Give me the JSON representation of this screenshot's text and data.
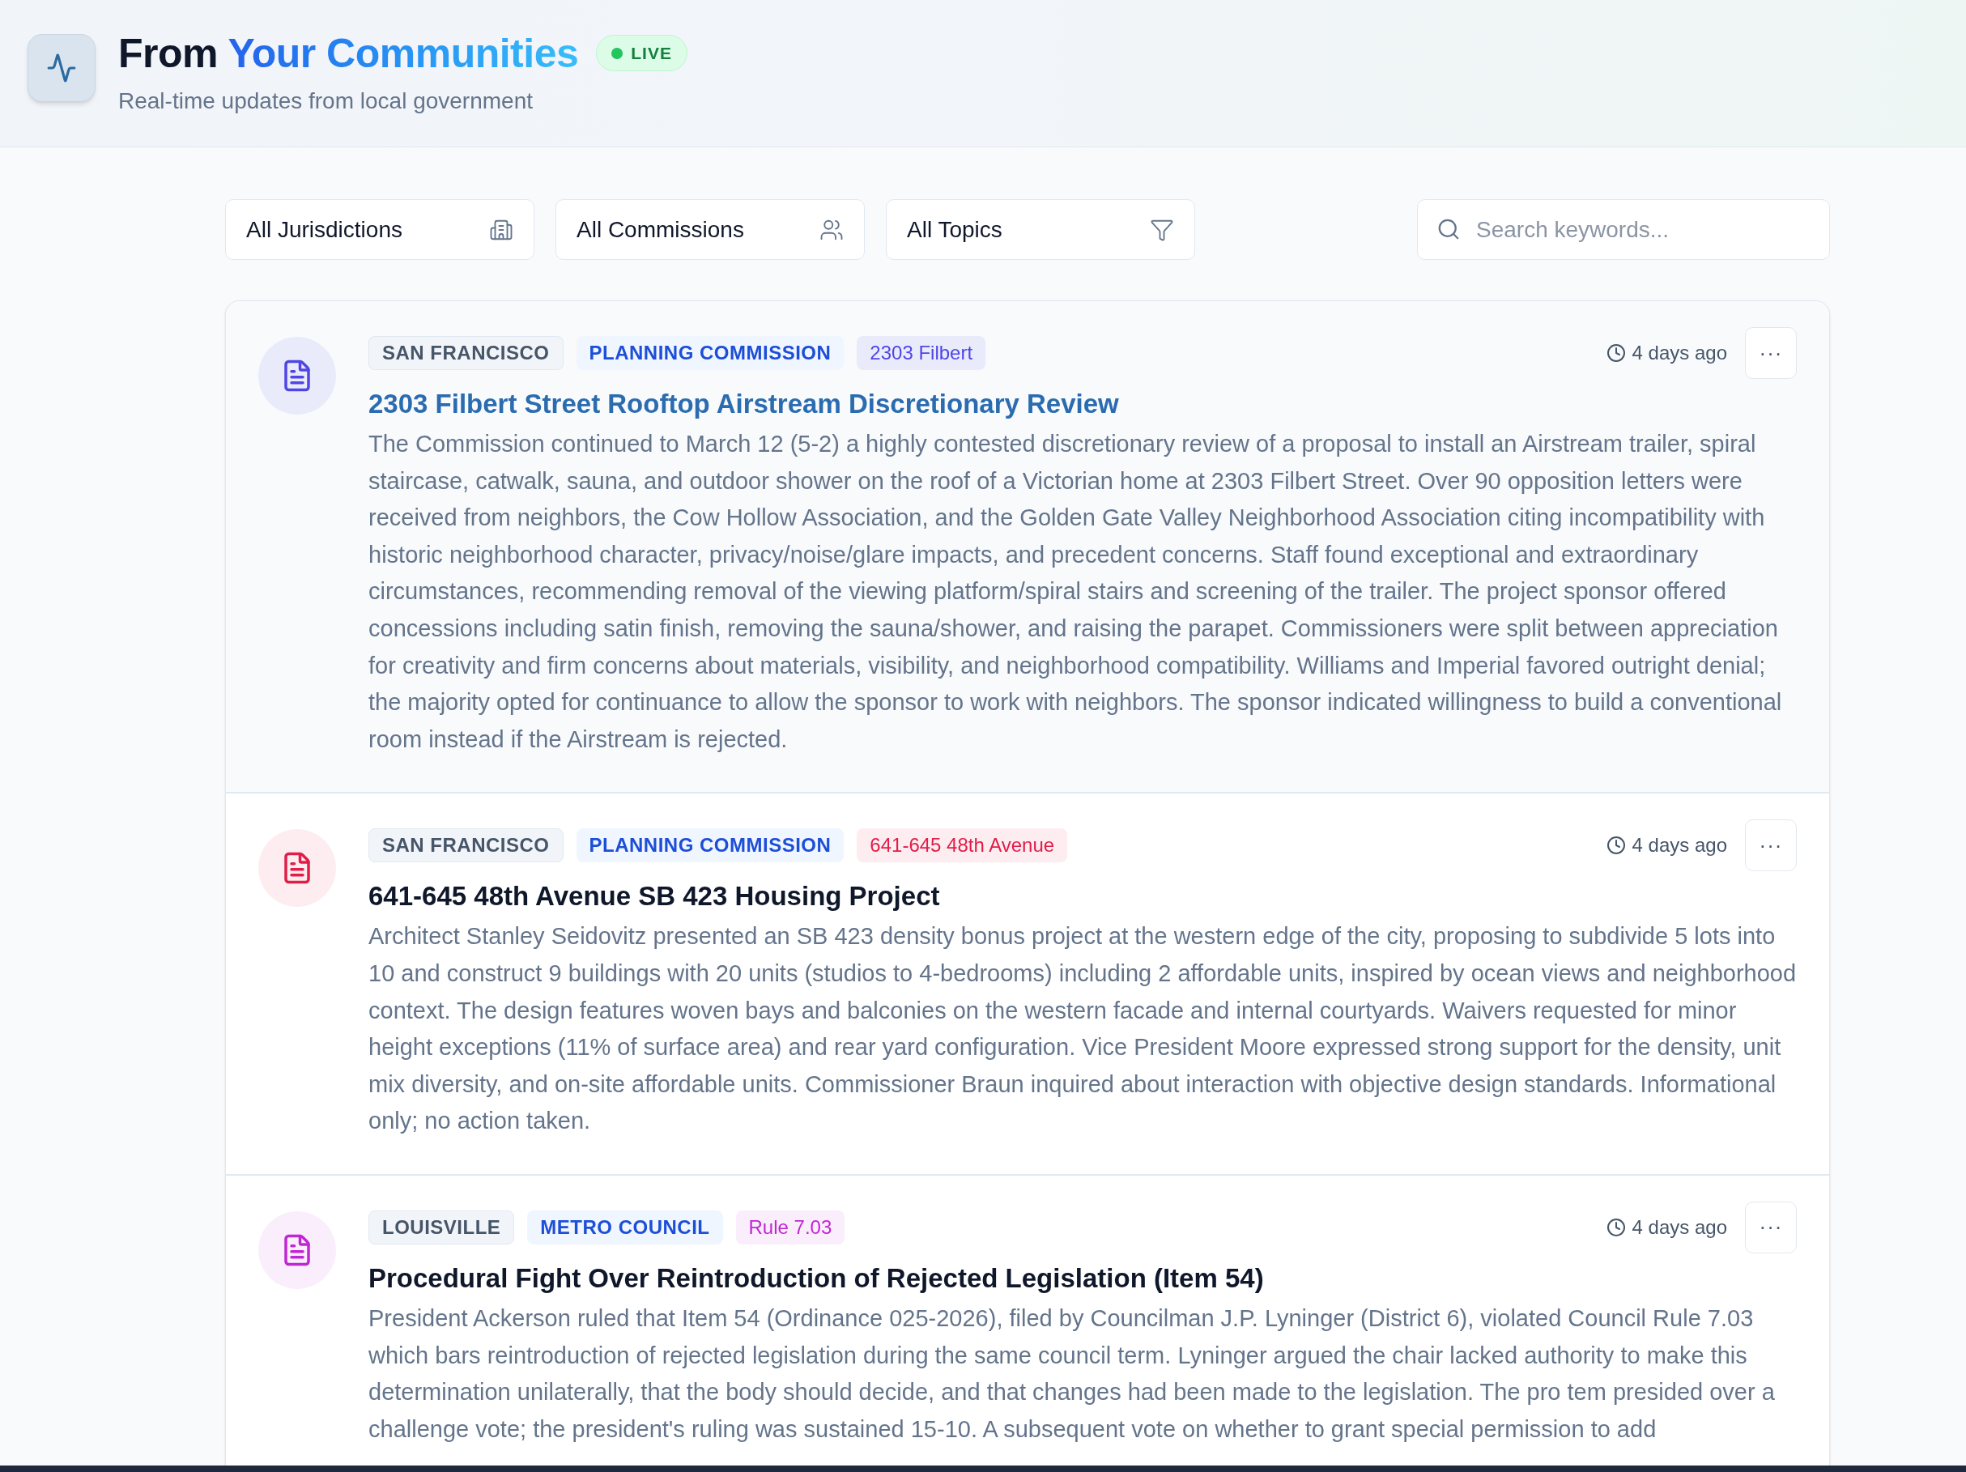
{
  "header": {
    "title_lead": "From",
    "title_highlight": "Your Communities",
    "badge": "LIVE",
    "subtitle": "Real-time updates from local government"
  },
  "filters": [
    {
      "label": "All Jurisdictions",
      "kind": "building"
    },
    {
      "label": "All Commissions",
      "kind": "people"
    },
    {
      "label": "All Topics",
      "kind": "funnel"
    }
  ],
  "search": {
    "placeholder": "Search keywords..."
  },
  "items": [
    {
      "selected": true,
      "color": "#4f46e5",
      "tags": [
        {
          "kind": "jurisdiction",
          "text": "SAN FRANCISCO"
        },
        {
          "kind": "commission",
          "text": "PLANNING COMMISSION"
        },
        {
          "kind": "topic",
          "text": "2303 Filbert"
        }
      ],
      "time": "4 days ago",
      "menu": "···",
      "title": "2303 Filbert Street Rooftop Airstream Discretionary Review",
      "body": "The Commission continued to March 12 (5-2) a highly contested discretionary review of a proposal to install an Airstream trailer, spiral staircase, catwalk, sauna, and outdoor shower on the roof of a Victorian home at 2303 Filbert Street. Over 90 opposition letters were received from neighbors, the Cow Hollow Association, and the Golden Gate Valley Neighborhood Association citing incompatibility with historic neighborhood character, privacy/noise/glare impacts, and precedent concerns. Staff found exceptional and extraordinary circumstances, recommending removal of the viewing platform/spiral stairs and screening of the trailer. The project sponsor offered concessions including satin finish, removing the sauna/shower, and raising the parapet. Commissioners were split between appreciation for creativity and firm concerns about materials, visibility, and neighborhood compatibility. Williams and Imperial favored outright denial; the majority opted for continuance to allow the sponsor to work with neighbors. The sponsor indicated willingness to build a conventional room instead if the Airstream is rejected."
    },
    {
      "selected": false,
      "color": "#e11d48",
      "tags": [
        {
          "kind": "jurisdiction",
          "text": "SAN FRANCISCO"
        },
        {
          "kind": "commission",
          "text": "PLANNING COMMISSION"
        },
        {
          "kind": "topic",
          "text": "641-645 48th Avenue"
        }
      ],
      "time": "4 days ago",
      "menu": "···",
      "title": "641-645 48th Avenue SB 423 Housing Project",
      "body": "Architect Stanley Seidovitz presented an SB 423 density bonus project at the western edge of the city, proposing to subdivide 5 lots into 10 and construct 9 buildings with 20 units (studios to 4-bedrooms) including 2 affordable units, inspired by ocean views and neighborhood context. The design features woven bays and balconies on the western facade and internal courtyards. Waivers requested for minor height exceptions (11% of surface area) and rear yard configuration. Vice President Moore expressed strong support for the density, unit mix diversity, and on-site affordable units. Commissioner Braun inquired about interaction with objective design standards. Informational only; no action taken."
    },
    {
      "selected": false,
      "color": "#c026d3",
      "tags": [
        {
          "kind": "jurisdiction",
          "text": "LOUISVILLE"
        },
        {
          "kind": "commission",
          "text": "METRO COUNCIL"
        },
        {
          "kind": "topic",
          "text": "Rule 7.03"
        }
      ],
      "time": "4 days ago",
      "menu": "···",
      "title": "Procedural Fight Over Reintroduction of Rejected Legislation (Item 54)",
      "body": "President Ackerson ruled that Item 54 (Ordinance 025-2026), filed by Councilman J.P. Lyninger (District 6), violated Council Rule 7.03 which bars reintroduction of rejected legislation during the same council term. Lyninger argued the chair lacked authority to make this determination unilaterally, that the body should decide, and that changes had been made to the legislation. The pro tem presided over a challenge vote; the president's ruling was sustained 15-10. A subsequent vote on whether to grant special permission to add"
    }
  ]
}
